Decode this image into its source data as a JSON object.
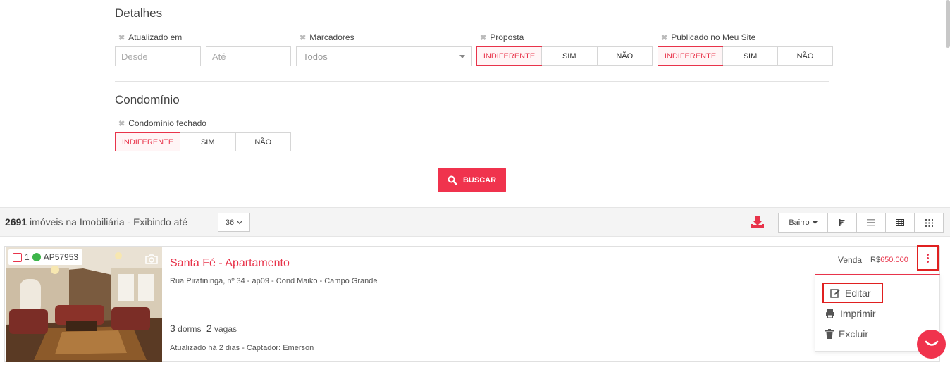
{
  "detalhes": {
    "title": "Detalhes",
    "atualizado": {
      "label": "Atualizado em",
      "desde_placeholder": "Desde",
      "ate_placeholder": "Até"
    },
    "marcadores": {
      "label": "Marcadores",
      "value": "Todos"
    },
    "proposta": {
      "label": "Proposta",
      "options": [
        "INDIFERENTE",
        "SIM",
        "NÃO"
      ],
      "selected": "INDIFERENTE"
    },
    "publicado": {
      "label": "Publicado no Meu Site",
      "options": [
        "INDIFERENTE",
        "SIM",
        "NÃO"
      ],
      "selected": "INDIFERENTE"
    }
  },
  "condominio": {
    "title": "Condomínio",
    "fechado": {
      "label": "Condomínio fechado",
      "options": [
        "INDIFERENTE",
        "SIM",
        "NÃO"
      ],
      "selected": "INDIFERENTE"
    }
  },
  "buscar_label": "BUSCAR",
  "results": {
    "count": "2691",
    "text": " imóveis na Imobiliária - Exibindo até",
    "per_page": "36",
    "bairro_label": "Bairro"
  },
  "listing": {
    "index": "1",
    "code": "AP57953",
    "status_color": "#3cb54a",
    "title": "Santa Fé - Apartamento",
    "address": "Rua Piratininga, nº 34 - ap09 - Cond Maiko - Campo Grande",
    "dorms_count": "3",
    "dorms_label": "dorms",
    "vagas_count": "2",
    "vagas_label": "vagas",
    "updated": "Atualizado há 2 dias - Captador: Emerson",
    "deal": "Venda",
    "currency": "R$",
    "price": "650.000"
  },
  "menu": {
    "editar": "Editar",
    "imprimir": "Imprimir",
    "excluir": "Excluir"
  },
  "colors": {
    "accent": "#f0334d",
    "highlight_box": "#e02020"
  }
}
